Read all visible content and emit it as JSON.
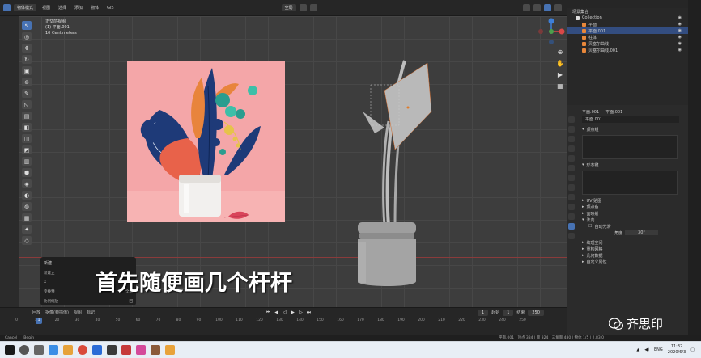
{
  "topbar": {
    "mode": "物体模式",
    "menus": [
      "视图",
      "选择",
      "添加",
      "物体",
      "GIS"
    ],
    "transform": "全局"
  },
  "viewport": {
    "info_line1": "正交前视图",
    "info_line2": "(1) 平面.001",
    "info_line3": "10 Centimeters"
  },
  "operator_panel": {
    "title": "新建",
    "row1_label": "新建立",
    "row2_label": "X",
    "row3_label": "变换预",
    "row4_label": "比例缩放",
    "row3_value": "全局",
    "row4_value": "回"
  },
  "subtitle": "首先随便画几个杆杆",
  "timeline": {
    "menu1": "回放",
    "menu2": "抠像(帧插值)",
    "menu3": "视图",
    "menu4": "标记",
    "current_frame": "1",
    "start_label": "起始",
    "start_value": "1",
    "end_label": "结束",
    "end_value": "250",
    "ruler": [
      "0",
      "10",
      "20",
      "30",
      "40",
      "50",
      "60",
      "70",
      "80",
      "90",
      "100",
      "110",
      "120",
      "130",
      "140",
      "150",
      "160",
      "170",
      "180",
      "190",
      "200",
      "210",
      "220",
      "230",
      "240",
      "250"
    ]
  },
  "status": {
    "left": "Cancel",
    "mid": "Begin",
    "right": "平面.001 | 顶点 384 | 面 324 | 三角面 480 | 物体 1/5 | 2.83.0"
  },
  "outliner": {
    "title": "场景集合",
    "items": [
      "Collection",
      "平面",
      "平面.001",
      "柱体",
      "贝塞尔曲线",
      "贝塞尔曲线.001"
    ],
    "selected_index": 2
  },
  "properties": {
    "object_name": "平面.001",
    "data_name": "平面.001",
    "sections": [
      "顶点组",
      "形态键",
      "UV 贴图",
      "顶点色",
      "面映射",
      "法向",
      "自动光滑"
    ],
    "lower_sections": [
      "纹理空间",
      "重构网格",
      "几何数据",
      "自定义属性"
    ],
    "angle_label": "角度",
    "angle_value": "30°"
  },
  "watermark": "齐思印",
  "taskbar": {
    "lang": "ENG",
    "time": "11:32",
    "date": "2020/6/3"
  },
  "colors": {
    "accent": "#4772b3",
    "image_bg": "#f4a6a8",
    "pot": "#f2f0ee"
  }
}
